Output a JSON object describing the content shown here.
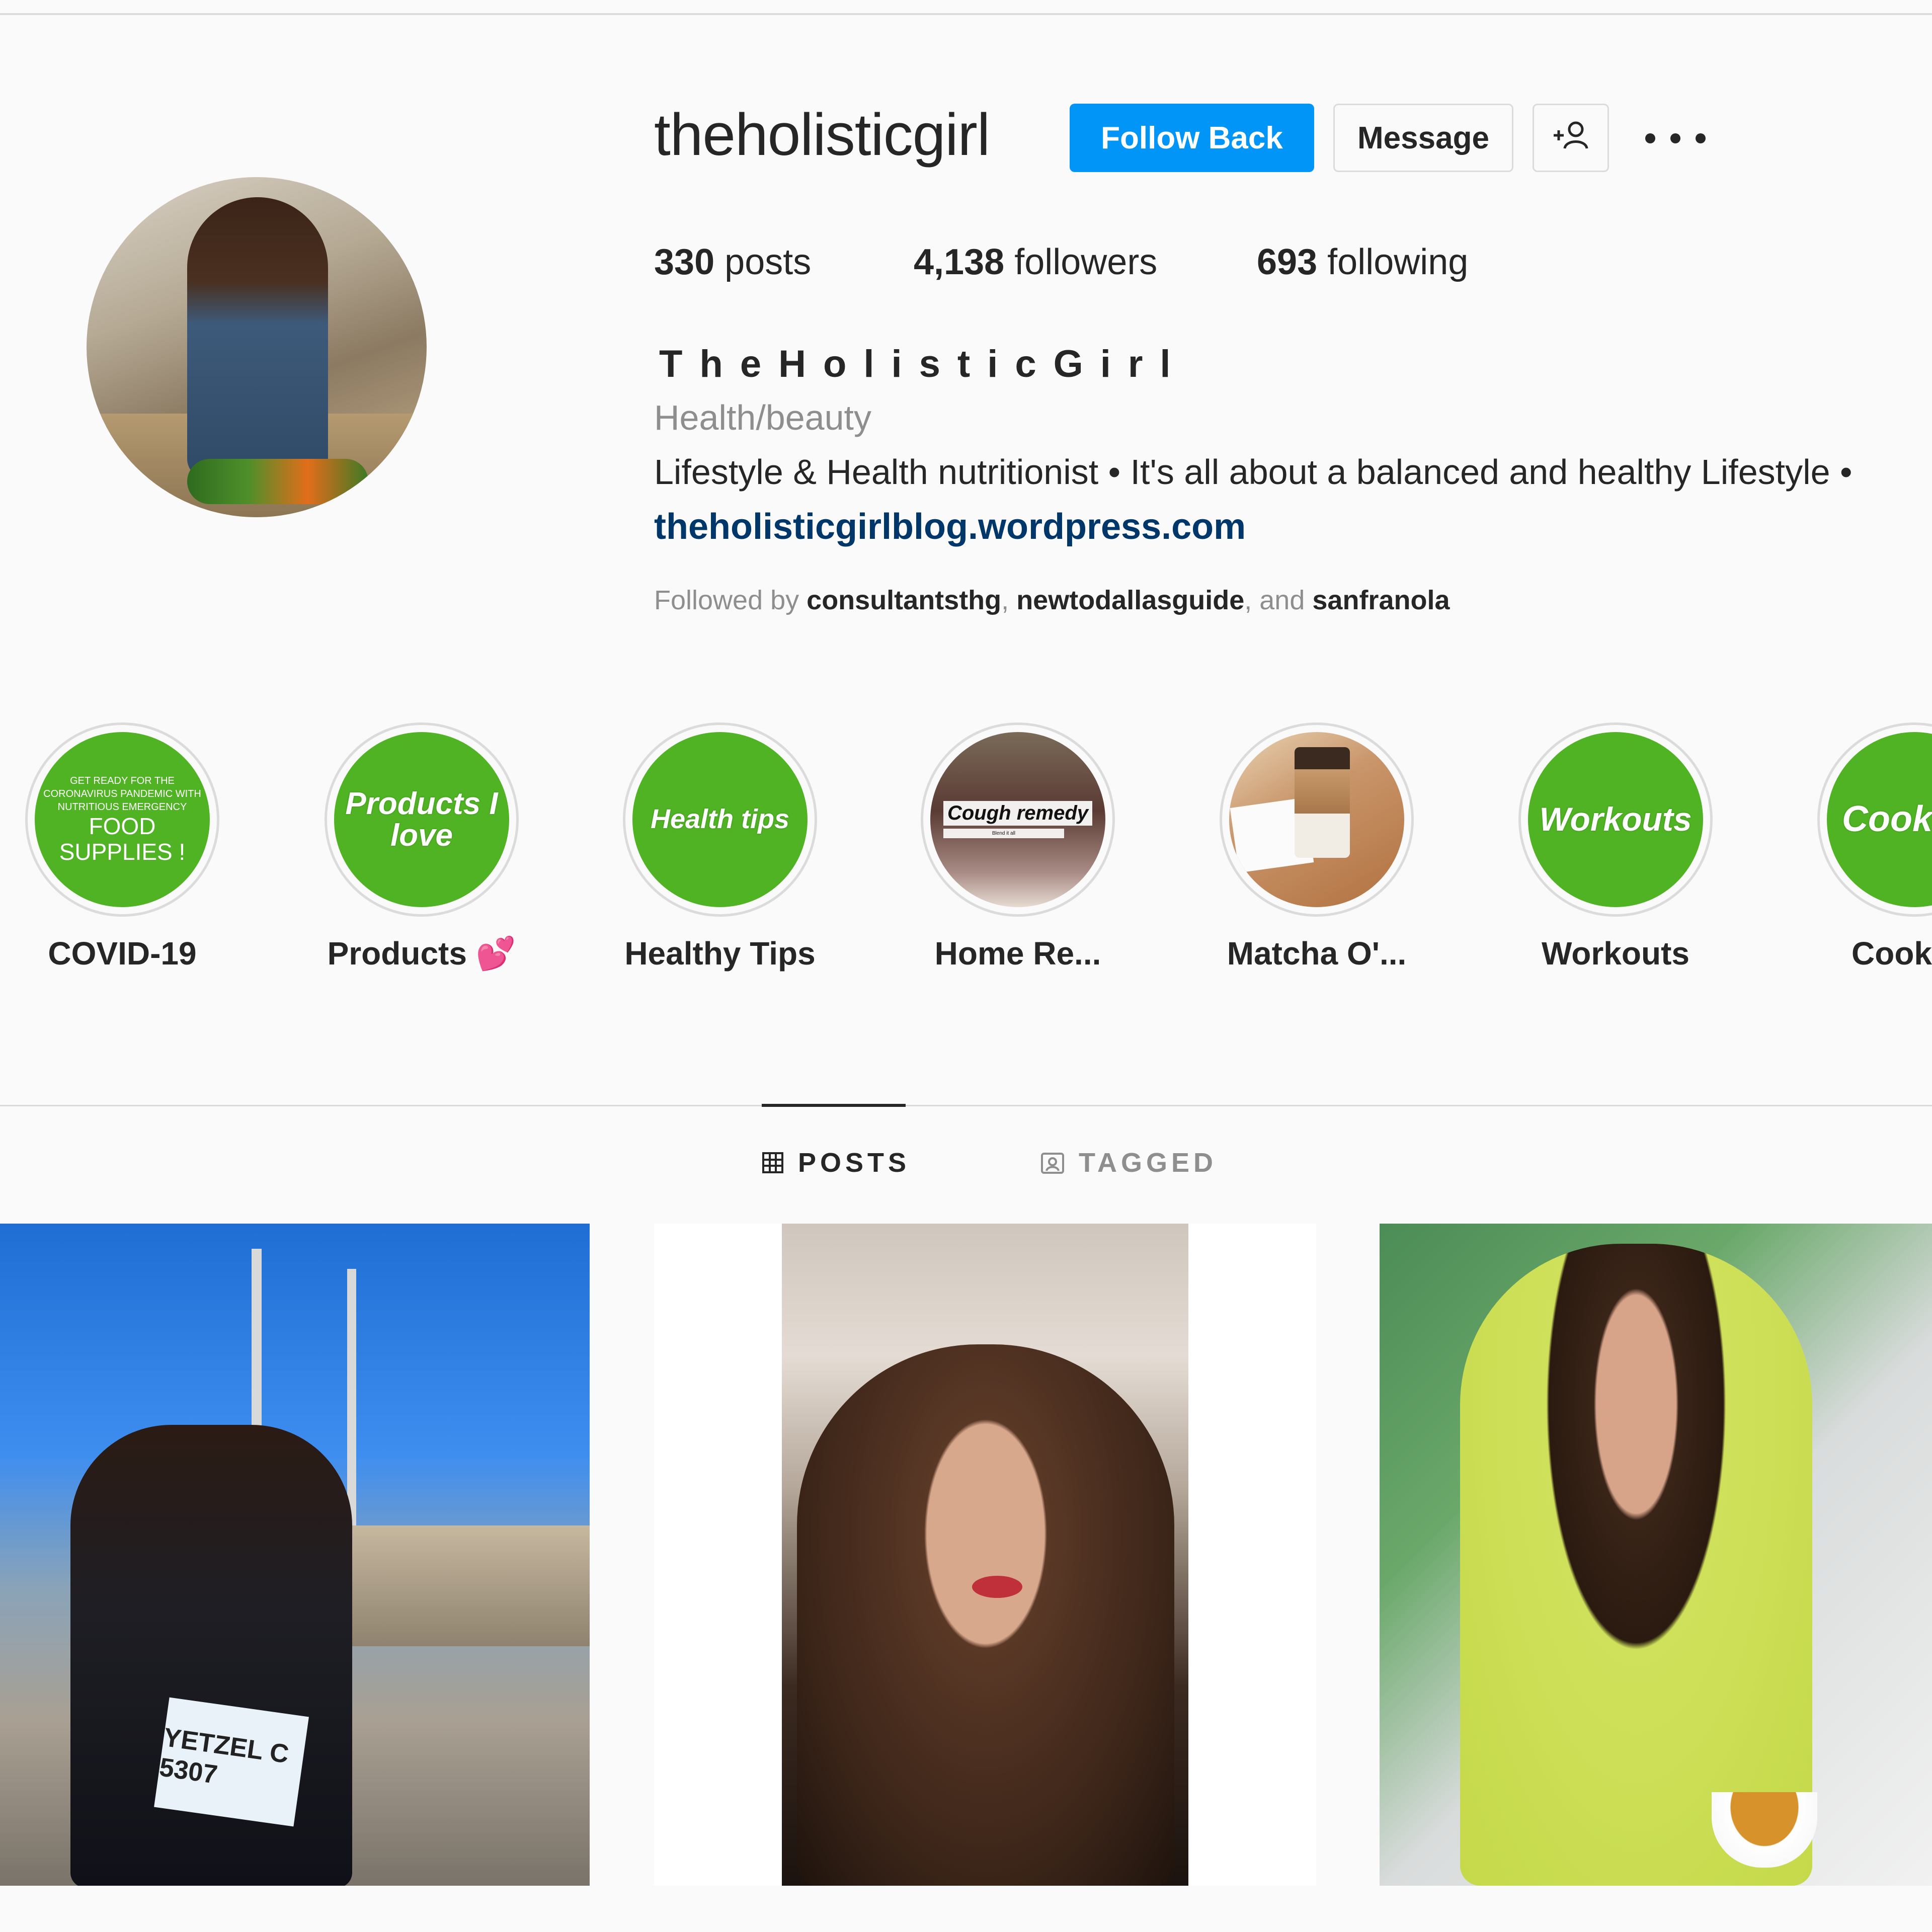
{
  "profile": {
    "username": "theholisticgirl",
    "follow_button": "Follow Back",
    "message_button": "Message",
    "stats": {
      "posts_count": "330",
      "posts_label": "posts",
      "followers_count": "4,138",
      "followers_label": "followers",
      "following_count": "693",
      "following_label": "following"
    },
    "full_name": "TheHolisticGirl",
    "category": "Health/beauty",
    "bio": "Lifestyle & Health nutritionist • It's all about a balanced and healthy Lifestyle •",
    "link": "theholisticgirlblog.wordpress.com",
    "followed_by": {
      "prefix": "Followed by",
      "users": [
        "consultantsthg",
        "newtodallasguide",
        "sanfranola"
      ],
      "sep1": ",",
      "sep2": ", and"
    }
  },
  "highlights": [
    {
      "label": "COVID-19",
      "cover_small": "GET READY FOR THE CORONAVIRUS PANDEMIC WITH NUTRITIOUS EMERGENCY",
      "cover_text": "FOOD SUPPLIES !"
    },
    {
      "label": "Products 💕",
      "cover_text": "Products I love"
    },
    {
      "label": "Healthy Tips",
      "cover_text": "Health tips"
    },
    {
      "label": "Home Re...",
      "cover_text": "Cough remedy",
      "cover_small": "Blend it all"
    },
    {
      "label": "Matcha O'..."
    },
    {
      "label": "Workouts",
      "cover_text": "Workouts"
    },
    {
      "label": "Cook",
      "cover_text": "Cook"
    }
  ],
  "tabs": {
    "posts": "POSTS",
    "tagged": "TAGGED"
  },
  "posts": [
    {
      "bib_text": "YETZEL C 5307"
    }
  ],
  "colors": {
    "primary_button": "#0095f6",
    "link": "#00376b",
    "highlight_green": "#4fb324",
    "secondary_text": "#8e8e8e"
  },
  "icons": [
    "suggest-person-icon",
    "more-options-icon",
    "grid-icon",
    "tagged-icon"
  ]
}
